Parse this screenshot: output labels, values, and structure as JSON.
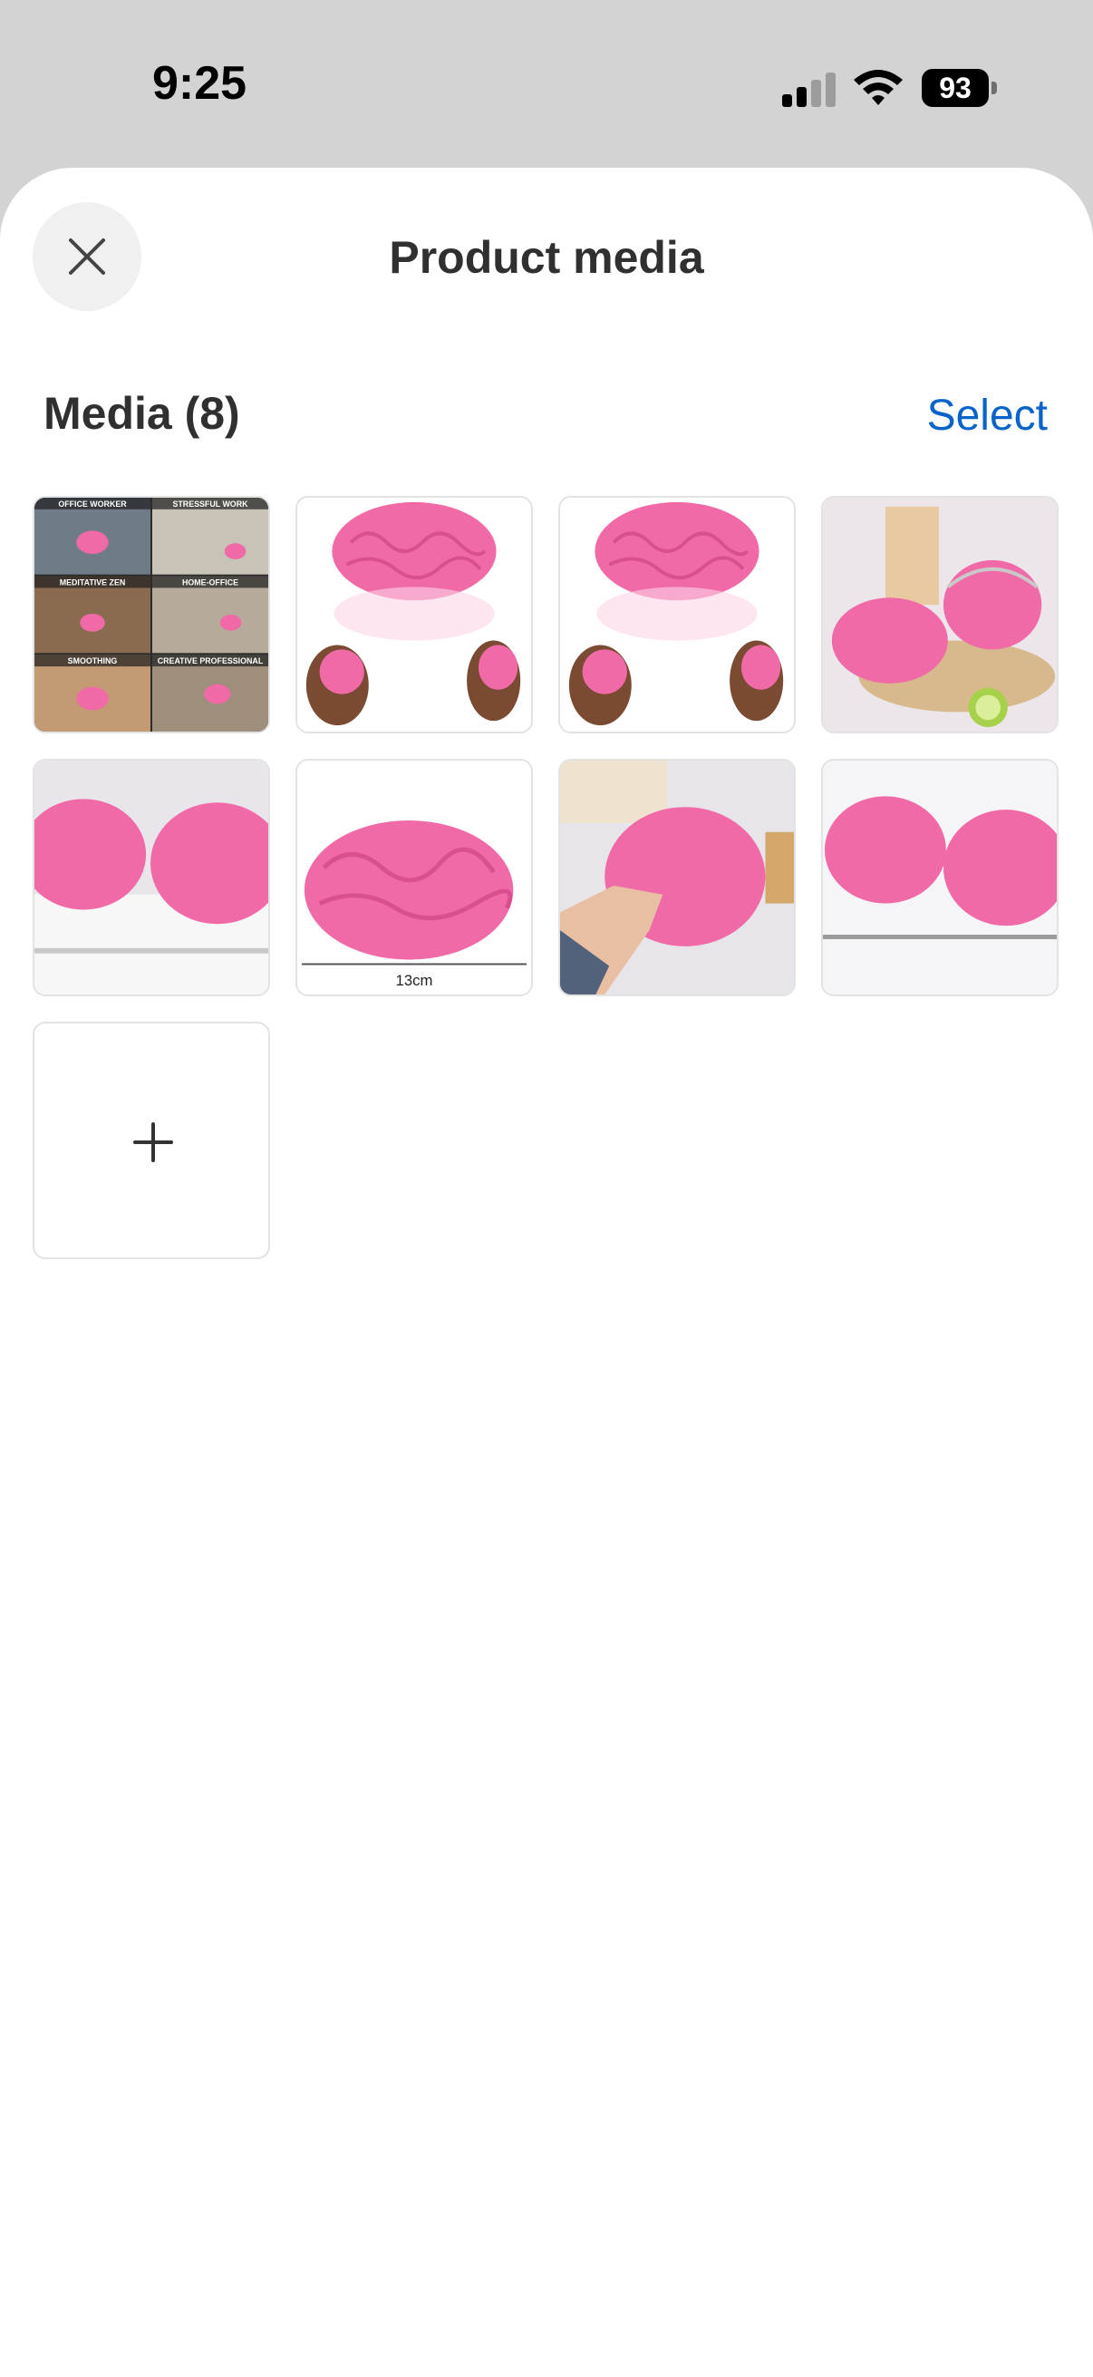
{
  "status_bar": {
    "time": "9:25",
    "battery": "93",
    "icons": [
      "signal-icon",
      "wifi-icon",
      "battery-icon"
    ]
  },
  "sheet": {
    "title": "Product media",
    "close_icon": "close-icon"
  },
  "media": {
    "heading": "Media (8)",
    "select_label": "Select",
    "add_icon": "plus-icon",
    "thumbnails": [
      {
        "description": "collage",
        "labels": [
          "OFFICE WORKER",
          "STRESSFUL WORK",
          "MEDITATIVE ZEN",
          "HOME-OFFICE",
          "SMOOTHING",
          "CREATIVE PROFESSIONAL"
        ]
      },
      {
        "description": "brain-with-hands"
      },
      {
        "description": "brain-with-hands"
      },
      {
        "description": "brains-in-basket"
      },
      {
        "description": "two-brains-side"
      },
      {
        "description": "brain-size",
        "size_label": "13cm"
      },
      {
        "description": "hand-squeezing-brain"
      },
      {
        "description": "two-brains-side"
      }
    ]
  },
  "colors": {
    "accent": "#0a63c9",
    "brain_pink": "#f06aa8",
    "background_gray": "#d3d3d3"
  }
}
